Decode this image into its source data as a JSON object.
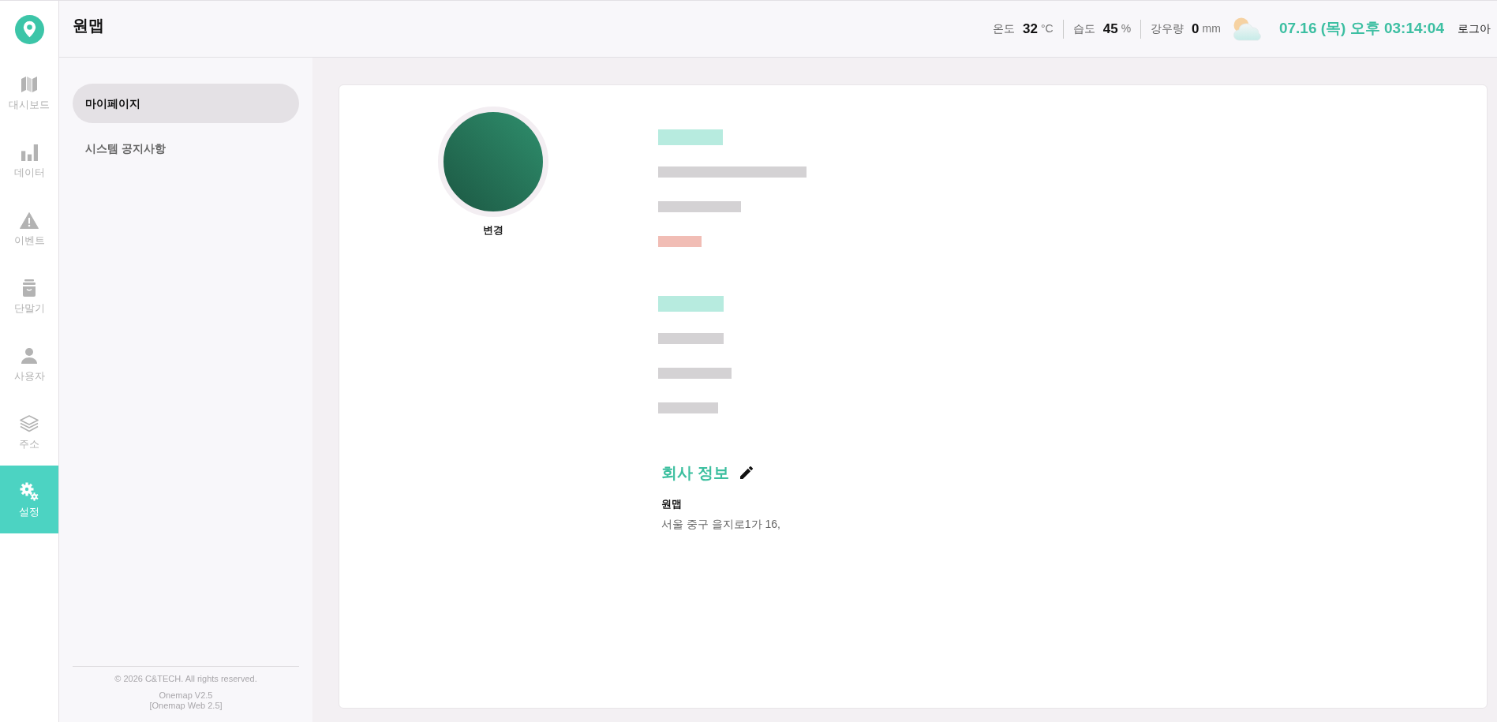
{
  "sidebar": {
    "items": [
      {
        "label": "대시보드",
        "selected": false
      },
      {
        "label": "데이터",
        "selected": false
      },
      {
        "label": "이벤트",
        "selected": false
      },
      {
        "label": "단말기",
        "selected": false
      },
      {
        "label": "사용자",
        "selected": false
      },
      {
        "label": "주소",
        "selected": false
      },
      {
        "label": "설정",
        "selected": true
      }
    ]
  },
  "header": {
    "title": "원맵",
    "weather": [
      {
        "label": "온도",
        "value": "32",
        "unit": "°C"
      },
      {
        "label": "습도",
        "value": "45",
        "unit": "%"
      },
      {
        "label": "강우량",
        "value": "0",
        "unit": "mm"
      }
    ],
    "datetime": "07.16 (목) 오후 03:14:04",
    "logout": "로그아"
  },
  "submenu": {
    "items": [
      {
        "label": "마이페이지",
        "selected": true
      },
      {
        "label": "시스템 공지사항",
        "selected": false
      }
    ],
    "footer": {
      "copyright": "© 2026 C&TECH. All rights reserved.",
      "version": "Onemap V2.5",
      "build": "[Onemap Web 2.5]"
    }
  },
  "profile": {
    "change_label": "변경",
    "redacted_groups": [
      [
        {
          "kind": "heading"
        },
        {
          "kind": "text"
        },
        {
          "kind": "text"
        },
        {
          "kind": "warning"
        }
      ],
      [
        {
          "kind": "heading"
        },
        {
          "kind": "text"
        },
        {
          "kind": "text"
        },
        {
          "kind": "text"
        }
      ]
    ],
    "company": {
      "title": "회사 정보",
      "name": "원맵",
      "address": "서울 중구 을지로1가 16,"
    }
  }
}
